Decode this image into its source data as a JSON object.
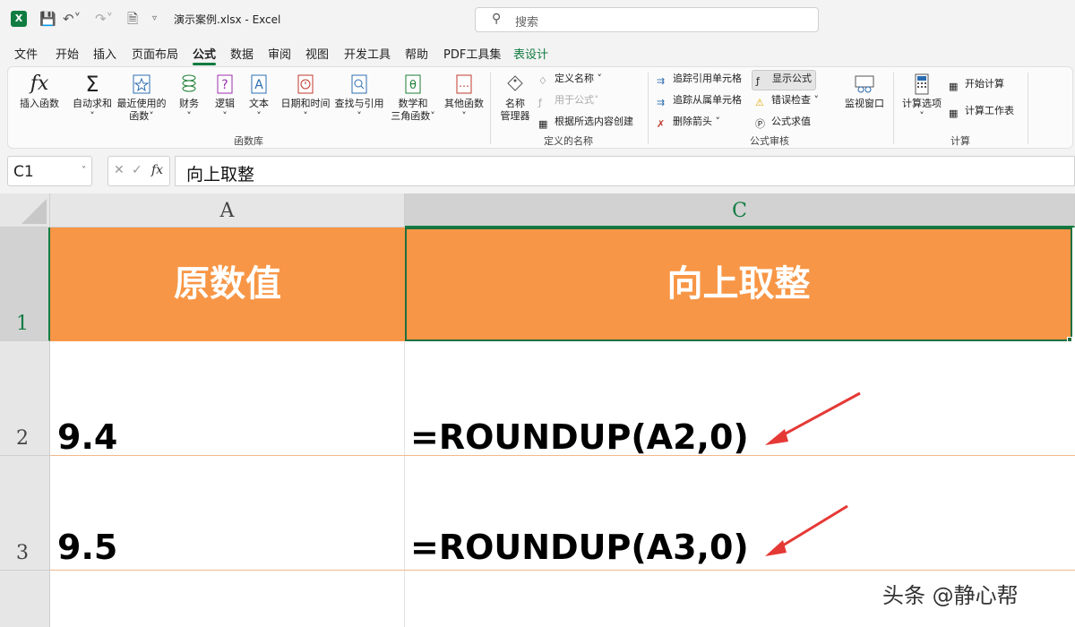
{
  "titlebar": {
    "app_icon": "X",
    "doc_title": "演示案例.xlsx - Excel",
    "search_placeholder": "搜索"
  },
  "menu": {
    "items": [
      "文件",
      "开始",
      "插入",
      "页面布局",
      "公式",
      "数据",
      "审阅",
      "视图",
      "开发工具",
      "帮助",
      "PDF工具集",
      "表设计"
    ],
    "active": "公式"
  },
  "ribbon": {
    "function_library": {
      "label": "函数库",
      "buttons": [
        "插入函数",
        "自动求和",
        "最近使用的",
        "函数",
        "财务",
        "逻辑",
        "文本",
        "日期和时间",
        "查找与引用",
        "数学和",
        "三角函数",
        "其他函数"
      ]
    },
    "defined_names": {
      "label": "定义的名称",
      "name_manager": "名称",
      "name_manager_2": "管理器",
      "items": [
        "定义名称",
        "用于公式",
        "根据所选内容创建"
      ]
    },
    "formula_auditing": {
      "label": "公式审核",
      "items": [
        "追踪引用单元格",
        "追踪从属单元格",
        "删除箭头",
        "显示公式",
        "错误检查",
        "公式求值"
      ],
      "watch_window": "监视窗口"
    },
    "calculation": {
      "label": "计算",
      "options": "计算选项",
      "items": [
        "开始计算",
        "计算工作表"
      ]
    }
  },
  "formula_bar": {
    "name_box": "C1",
    "formula": "向上取整"
  },
  "sheet": {
    "columns": [
      "A",
      "C"
    ],
    "rows": [
      "1",
      "2",
      "3"
    ],
    "header_a": "原数值",
    "header_c": "向上取整",
    "header_color": "#f79646",
    "row2": {
      "a": "9.4",
      "c": "=ROUNDUP(A2,0)"
    },
    "row3": {
      "a": "9.5",
      "c": "=ROUNDUP(A3,0)"
    }
  },
  "watermark": "头条 @静心帮",
  "accent_color": "#107c41",
  "arrow_color": "#e53935"
}
